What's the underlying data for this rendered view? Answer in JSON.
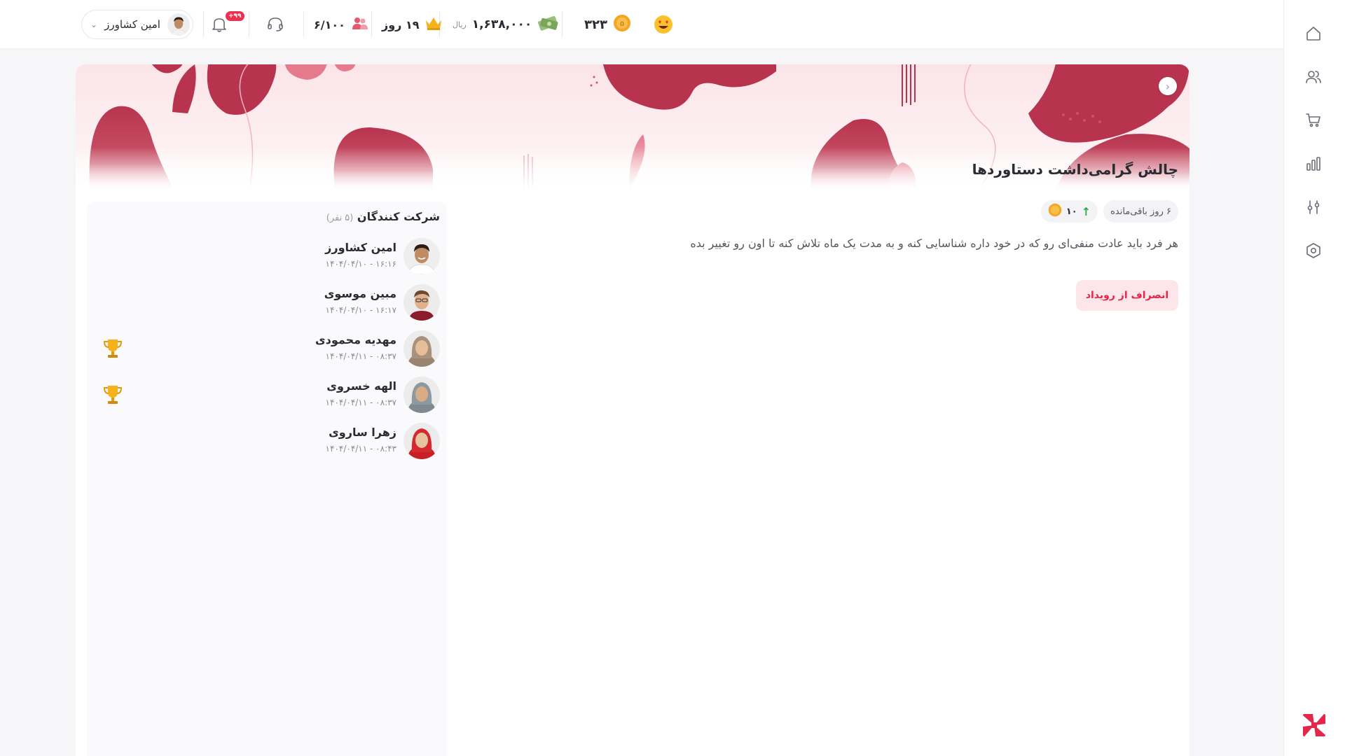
{
  "topbar": {
    "user_name": "امین کشاورز",
    "notifications_badge": "+۹۹",
    "friends": "۶/۱۰۰",
    "days": "۱۹ روز",
    "money": "۱,۶۳۸,۰۰۰",
    "money_unit": "ریال",
    "coins": "۳۲۳"
  },
  "challenge": {
    "title": "چالش گرامی‌داشت دستاوردها",
    "remaining": "۶ روز باقی‌مانده",
    "reward": "۱۰",
    "description": "هر فرد باید عادت منفی‌ای رو که در خود داره شناسایی کنه و به مدت یک ماه تلاش کنه تا اون رو تغییر بده",
    "leave_label": "انصراف از رویداد"
  },
  "participants": {
    "title": "شرکت کنندگان",
    "count": "(۵ نفر)",
    "items": [
      {
        "name": "امین کشاورز",
        "time": "۱۶:۱۶ - ۱۴۰۴/۰۴/۱۰",
        "trophy": false
      },
      {
        "name": "مبین موسوی",
        "time": "۱۶:۱۷ - ۱۴۰۴/۰۴/۱۰",
        "trophy": false
      },
      {
        "name": "مهدیه محمودی",
        "time": "۰۸:۳۷ - ۱۴۰۴/۰۴/۱۱",
        "trophy": true
      },
      {
        "name": "الهه خسروی",
        "time": "۰۸:۳۷ - ۱۴۰۴/۰۴/۱۱",
        "trophy": true
      },
      {
        "name": "زهرا ساروی",
        "time": "۰۸:۴۳ - ۱۴۰۴/۰۴/۱۱",
        "trophy": false
      }
    ]
  },
  "sidebar": {
    "icons": [
      "home-icon",
      "users-icon",
      "cart-icon",
      "chart-icon",
      "settings-sliders-icon",
      "hexagon-settings-icon"
    ]
  },
  "colors": {
    "accent": "#e3264a",
    "hero_shape": "#b8344e",
    "hero_bg": "#fbe4e8"
  }
}
